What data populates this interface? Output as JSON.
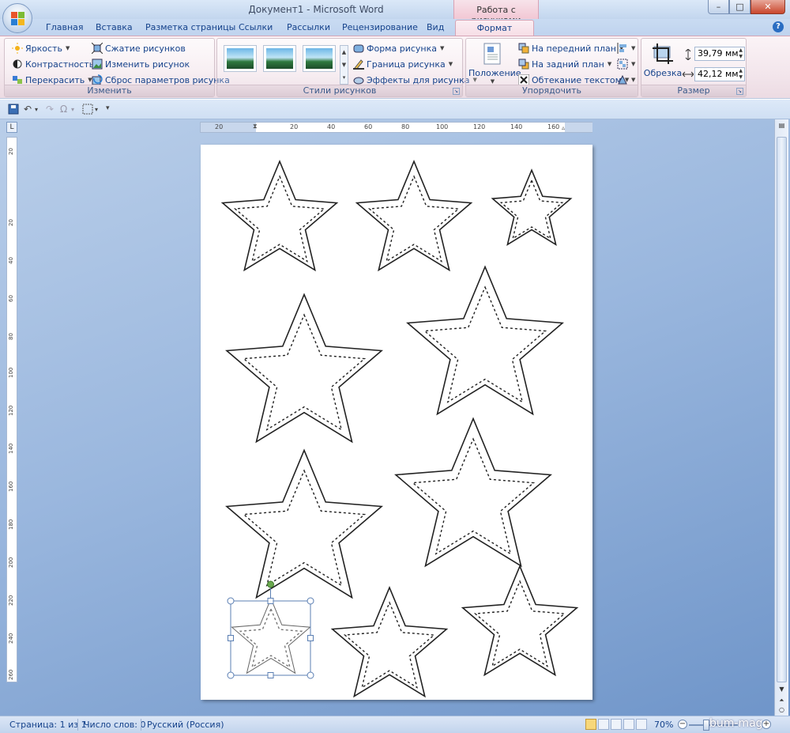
{
  "window": {
    "title": "Документ1 - Microsoft Word",
    "context_group": "Работа с рисунками",
    "controls": [
      "–",
      "□",
      "✕"
    ]
  },
  "tabs": [
    "Главная",
    "Вставка",
    "Разметка страницы",
    "Ссылки",
    "Рассылки",
    "Рецензирование",
    "Вид",
    "Формат"
  ],
  "active_tab": "Формат",
  "ribbon": {
    "adjust": {
      "label": "Изменить",
      "brightness": "Яркость",
      "contrast": "Контрастность",
      "recolor": "Перекрасить",
      "compress": "Сжатие рисунков",
      "change": "Изменить рисунок",
      "reset": "Сброс параметров рисунка"
    },
    "styles": {
      "label": "Стили рисунков",
      "shape": "Форма рисунка",
      "border": "Граница рисунка",
      "effects": "Эффекты для рисунка"
    },
    "arrange": {
      "label": "Упорядочить",
      "position": "Положение",
      "bring_front": "На передний план",
      "send_back": "На задний план",
      "wrap": "Обтекание текстом"
    },
    "size": {
      "label": "Размер",
      "crop": "Обрезка",
      "height": "39,79 мм",
      "width": "42,12 мм"
    }
  },
  "ruler": {
    "horizontal_labels": [
      "20",
      "20",
      "40",
      "60",
      "80",
      "100",
      "120",
      "140",
      "160"
    ],
    "vertical_labels": [
      "20",
      "20",
      "40",
      "60",
      "80",
      "100",
      "120",
      "140",
      "160",
      "180",
      "200",
      "220",
      "240",
      "260"
    ]
  },
  "status": {
    "page": "Страница: 1 из 1",
    "words": "Число слов: 0",
    "language": "Русский (Россия)",
    "zoom": "70%",
    "watermark": "bum-mag"
  },
  "colors": {
    "ribbon_accent": "#f6dde5",
    "workspace": "#8fb0dc",
    "text": "#15428b",
    "selection_handle": "#6aa84f"
  }
}
